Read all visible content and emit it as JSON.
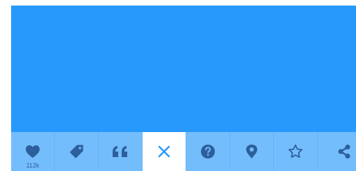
{
  "colors": {
    "panel": "#2899fc",
    "toolbar": "#74bdfd",
    "icon": "#2c5f9b",
    "close_icon": "#2899fc",
    "active_button": "#ffffff"
  },
  "toolbar": {
    "like_count": "112k",
    "buttons": [
      {
        "name": "like",
        "icon": "heart-icon"
      },
      {
        "name": "tag",
        "icon": "tag-icon"
      },
      {
        "name": "quote",
        "icon": "quote-icon"
      },
      {
        "name": "close",
        "icon": "close-icon"
      },
      {
        "name": "help",
        "icon": "question-icon"
      },
      {
        "name": "location",
        "icon": "location-pin-icon"
      },
      {
        "name": "favorite",
        "icon": "star-icon"
      },
      {
        "name": "share",
        "icon": "share-icon"
      }
    ]
  }
}
